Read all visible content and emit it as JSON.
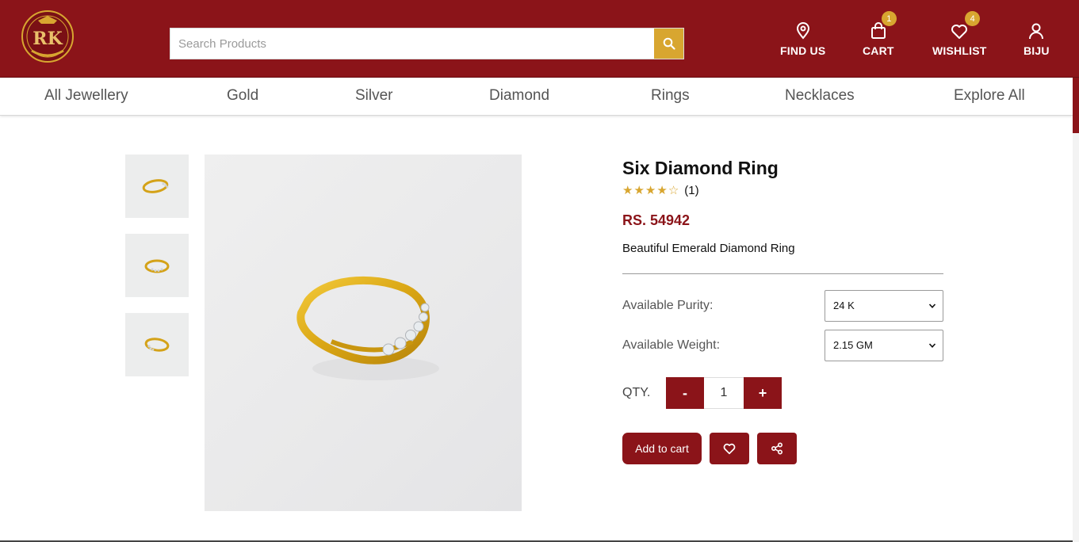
{
  "brand": {
    "logo_letters": "RK",
    "logo_subtext": "JEWELLERY",
    "primary_color": "#8b1419",
    "accent_color": "#d8a630"
  },
  "search": {
    "placeholder": "Search Products",
    "icon": "search-icon"
  },
  "header_actions": {
    "find_us": {
      "label": "FIND US",
      "icon": "location-pin-icon"
    },
    "cart": {
      "label": "CART",
      "icon": "shopping-bag-icon",
      "count": "1"
    },
    "wishlist": {
      "label": "WISHLIST",
      "icon": "heart-icon",
      "count": "4"
    },
    "account": {
      "label": "BIJU",
      "icon": "user-icon"
    }
  },
  "nav": {
    "items": [
      "All Jewellery",
      "Gold",
      "Silver",
      "Diamond",
      "Rings",
      "Necklaces",
      "Explore All"
    ]
  },
  "product": {
    "title": "Six Diamond Ring",
    "rating": 4,
    "rating_max": 5,
    "rating_count": "(1)",
    "price": "RS. 54942",
    "description": "Beautiful Emerald Diamond Ring",
    "purity_label": "Available Purity:",
    "purity_value": "24 K",
    "weight_label": "Available Weight:",
    "weight_value": "2.15 GM",
    "qty_label": "QTY.",
    "qty_minus": "-",
    "qty_value": "1",
    "qty_plus": "+",
    "add_to_cart": "Add to cart",
    "wishlist_icon": "heart-icon",
    "share_icon": "share-icon"
  }
}
